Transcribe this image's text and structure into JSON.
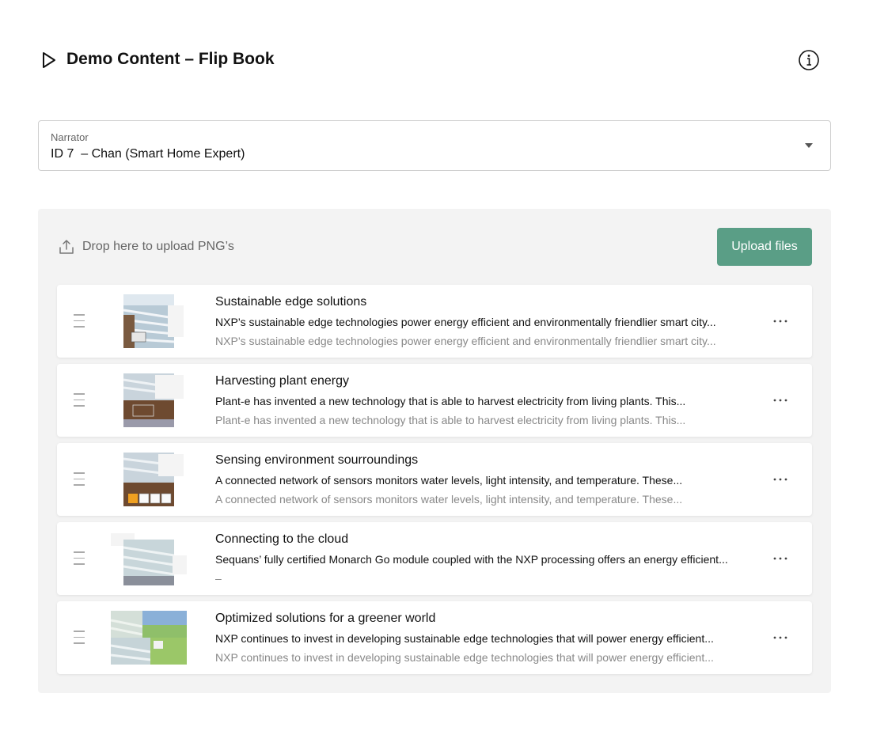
{
  "header": {
    "title": "Demo Content – Flip Book",
    "play_icon": "play-icon",
    "info_icon": "info-icon"
  },
  "narrator": {
    "label": "Narrator",
    "value": "ID 7  – Chan (Smart Home Expert)"
  },
  "upload": {
    "drop_text": "Drop here to upload PNG’s",
    "button_label": "Upload files",
    "button_color": "#5a9e86"
  },
  "items": [
    {
      "title": "Sustainable edge solutions",
      "description": "NXP’s sustainable edge technologies power energy efficient and environmentally friendlier smart city...",
      "secondary": "NXP’s sustainable edge technologies power energy efficient and environmentally friendlier smart city..."
    },
    {
      "title": "Harvesting plant energy",
      "description": "Plant-e has invented a new technology that is able to harvest electricity from living plants. This...",
      "secondary": "Plant-e has invented a new technology that is able to harvest electricity from living plants. This..."
    },
    {
      "title": "Sensing environment sourroundings",
      "description": "A connected network of sensors monitors water levels, light intensity, and temperature. These...",
      "secondary": "A connected network of sensors monitors water levels, light intensity, and temperature. These..."
    },
    {
      "title": "Connecting to the cloud",
      "description": "Sequans’ fully certified Monarch Go module coupled with the NXP processing offers an energy efficient...",
      "secondary": "–"
    },
    {
      "title": "Optimized solutions for a greener world",
      "description": "NXP continues to invest in developing sustainable edge technologies that will power energy efficient...",
      "secondary": "NXP continues to invest in developing sustainable edge technologies that will power energy efficient..."
    }
  ]
}
